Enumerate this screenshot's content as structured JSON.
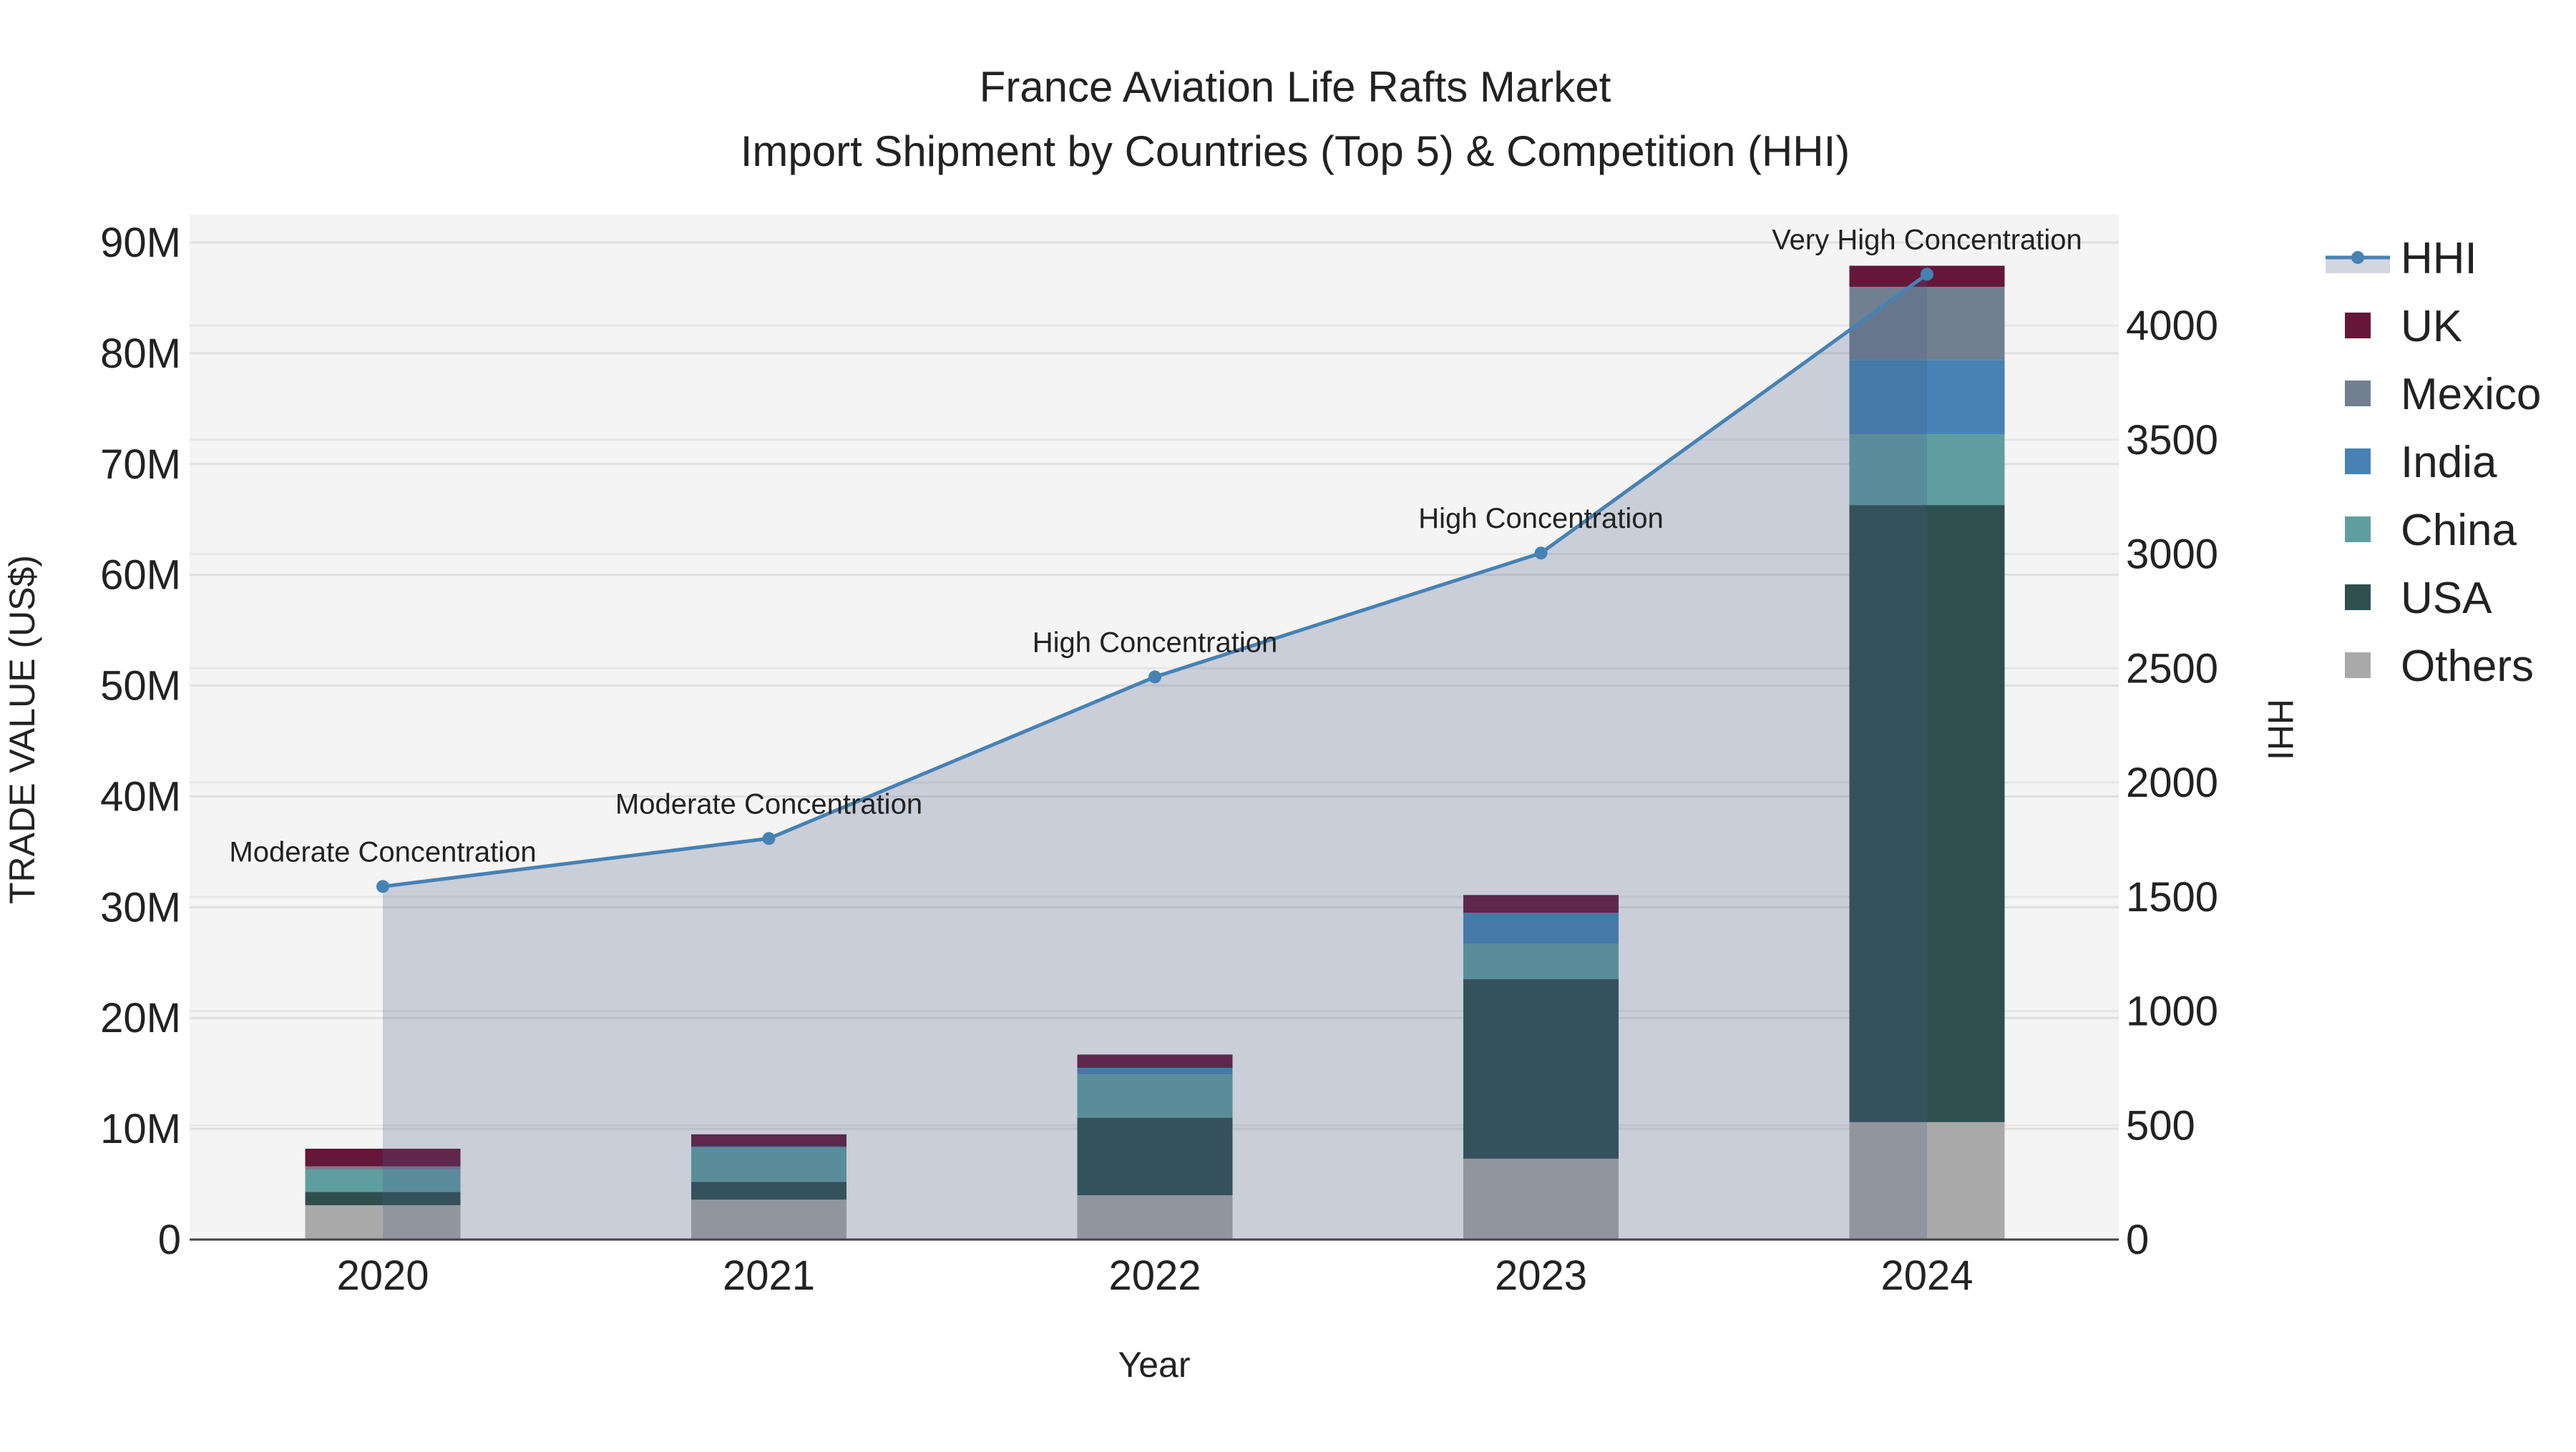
{
  "chart_data": {
    "type": "bar",
    "title": "France Aviation Life Rafts Market",
    "subtitle": "Import Shipment by Countries (Top 5) & Competition (HHI)",
    "xlabel": "Year",
    "ylabel": "TRADE VALUE (US$)",
    "y2label": "HHI",
    "categories": [
      "2020",
      "2021",
      "2022",
      "2023",
      "2024"
    ],
    "ylim": [
      0,
      93000000
    ],
    "yticks": [
      0,
      10000000,
      20000000,
      30000000,
      40000000,
      50000000,
      60000000,
      70000000,
      80000000,
      90000000
    ],
    "ytick_labels": [
      "0",
      "10M",
      "20M",
      "30M",
      "40M",
      "50M",
      "60M",
      "70M",
      "80M",
      "90M"
    ],
    "y2ticks": [
      0,
      500,
      1000,
      1500,
      2000,
      2500,
      3000,
      3500,
      4000
    ],
    "y2tick_labels": [
      "0",
      "500",
      "1000",
      "1500",
      "2000",
      "2500",
      "3000",
      "3500",
      "4000"
    ],
    "stacked": true,
    "series": [
      {
        "name": "Others",
        "color": "#a9a9a9",
        "values": [
          3100000,
          3600000,
          4000000,
          7300000,
          10600000
        ]
      },
      {
        "name": "USA",
        "color": "#2f4f4f",
        "values": [
          1200000,
          1600000,
          7000000,
          16200000,
          55700000
        ]
      },
      {
        "name": "China",
        "color": "#5f9ea0",
        "values": [
          2000000,
          3100000,
          3900000,
          3200000,
          6400000
        ]
      },
      {
        "name": "India",
        "color": "#4682b4",
        "values": [
          0,
          100000,
          600000,
          2800000,
          6700000
        ]
      },
      {
        "name": "Mexico",
        "color": "#708090",
        "values": [
          300000,
          0,
          0,
          0,
          6600000
        ]
      },
      {
        "name": "UK",
        "color": "#641739",
        "values": [
          1600000,
          1100000,
          1200000,
          1600000,
          1900000
        ]
      }
    ],
    "hhi": {
      "name": "HHI",
      "color": "#4682b4",
      "values": [
        1545,
        1755,
        2462,
        3004,
        4224
      ],
      "annotations": [
        "Moderate Concentration",
        "Moderate Concentration",
        "High Concentration",
        "High Concentration",
        "Very High Concentration"
      ]
    },
    "legend": [
      "HHI",
      "UK",
      "Mexico",
      "India",
      "China",
      "USA",
      "Others"
    ],
    "legend_position": "right",
    "grid": true
  }
}
